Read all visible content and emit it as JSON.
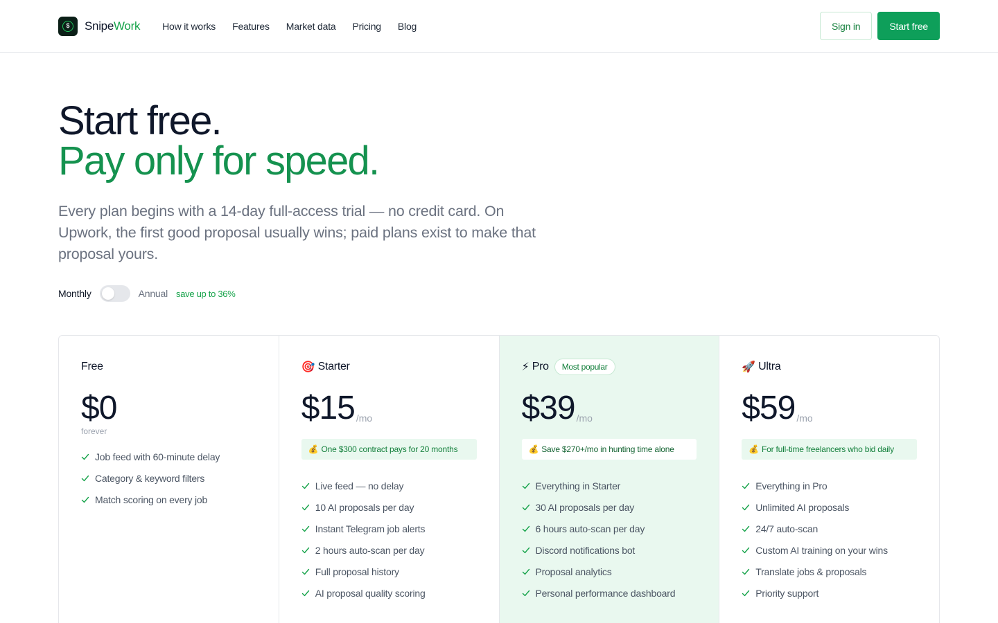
{
  "header": {
    "brand_first": "Snipe",
    "brand_second": "Work",
    "logo_glyph": "$",
    "nav": [
      "How it works",
      "Features",
      "Market data",
      "Pricing",
      "Blog"
    ],
    "sign_in": "Sign in",
    "start_free": "Start free"
  },
  "hero": {
    "line1": "Start free.",
    "line2": "Pay only for speed.",
    "subtitle": "Every plan begins with a 14-day full-access trial — no credit card. On Upwork, the first good proposal usually wins; paid plans exist to make that proposal yours."
  },
  "billing": {
    "monthly": "Monthly",
    "annual": "Annual",
    "save": "save up to 36%",
    "annual_selected": false
  },
  "plans": [
    {
      "emoji": "",
      "name": "Free",
      "price": "$0",
      "per": "",
      "sub": "forever",
      "note_icon": "",
      "note": "",
      "features": [
        "Job feed with 60-minute delay",
        "Category & keyword filters",
        "Match scoring on every job"
      ]
    },
    {
      "emoji": "🎯",
      "name": "Starter",
      "price": "$15",
      "per": "/mo",
      "sub": "",
      "note_icon": "💰",
      "note": "One $300 contract pays for 20 months",
      "features": [
        "Live feed — no delay",
        "10 AI proposals per day",
        "Instant Telegram job alerts",
        "2 hours auto-scan per day",
        "Full proposal history",
        "AI proposal quality scoring"
      ]
    },
    {
      "emoji": "⚡",
      "name": "Pro",
      "badge": "Most popular",
      "price": "$39",
      "per": "/mo",
      "sub": "",
      "note_icon": "💰",
      "note": "Save $270+/mo in hunting time alone",
      "features": [
        "Everything in Starter",
        "30 AI proposals per day",
        "6 hours auto-scan per day",
        "Discord notifications bot",
        "Proposal analytics",
        "Personal performance dashboard"
      ]
    },
    {
      "emoji": "🚀",
      "name": "Ultra",
      "price": "$59",
      "per": "/mo",
      "sub": "",
      "note_icon": "💰",
      "note": "For full-time freelancers who bid daily",
      "features": [
        "Everything in Pro",
        "Unlimited AI proposals",
        "24/7 auto-scan",
        "Custom AI training on your wins",
        "Translate jobs & proposals",
        "Priority support"
      ]
    }
  ],
  "colors": {
    "accent": "#0e9f5a",
    "accent_text": "#15924f",
    "featured_bg": "#e9f8ef",
    "check": "#16a34a"
  }
}
